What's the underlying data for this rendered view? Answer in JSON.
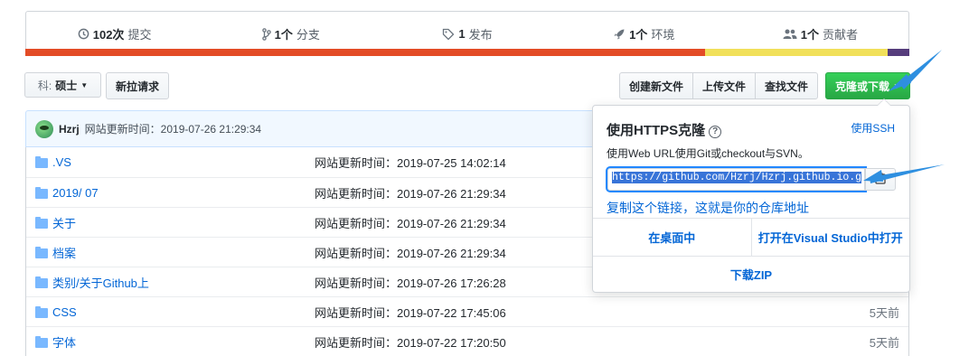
{
  "stats": [
    {
      "icon": "commit-icon",
      "count": "102次",
      "label": "提交"
    },
    {
      "icon": "branch-icon",
      "count": "1个",
      "label": "分支"
    },
    {
      "icon": "tag-icon",
      "count": "1",
      "label": "发布"
    },
    {
      "icon": "rocket-icon",
      "count": "1个",
      "label": "环境"
    },
    {
      "icon": "people-icon",
      "count": "1个",
      "label": "贡献者"
    }
  ],
  "language_colors": [
    "#e34c26",
    "#f1e05a",
    "#563d7c"
  ],
  "toolbar": {
    "branch_label": "科:",
    "branch_value": "硕士",
    "new_pr": "新拉请求",
    "create_file": "创建新文件",
    "upload_files": "上传文件",
    "find_file": "查找文件",
    "clone_download": "克隆或下载"
  },
  "commit": {
    "author": "Hzrj",
    "message": "网站更新时间：2019-07-26 21:29:34"
  },
  "files": [
    {
      "name": ".VS",
      "message": "网站更新时间：2019-07-25 14:02:14",
      "age": ""
    },
    {
      "name": "2019/ 07",
      "message": "网站更新时间：2019-07-26 21:29:34",
      "age": ""
    },
    {
      "name": "关于",
      "message": "网站更新时间：2019-07-26 21:29:34",
      "age": ""
    },
    {
      "name": "档案",
      "message": "网站更新时间：2019-07-26 21:29:34",
      "age": ""
    },
    {
      "name": "类别/关于Github上",
      "message": "网站更新时间：2019-07-26 17:26:28",
      "age": ""
    },
    {
      "name": "CSS",
      "message": "网站更新时间：2019-07-22 17:45:06",
      "age": "5天前"
    },
    {
      "name": "字体",
      "message": "网站更新时间：2019-07-22 17:20:50",
      "age": "5天前"
    }
  ],
  "clone": {
    "title": "使用HTTPS克隆",
    "use_ssh": "使用SSH",
    "description": "使用Web URL使用Git或checkout与SVN。",
    "url": "https://github.com/Hzrj/Hzrj.github.io.g",
    "note": "复制这个链接，这就是你的仓库地址",
    "open_desktop": "在桌面中",
    "open_vs": "打开在Visual Studio中打开",
    "download_zip": "下载ZIP"
  },
  "annotation_color": "#2e8fe0"
}
